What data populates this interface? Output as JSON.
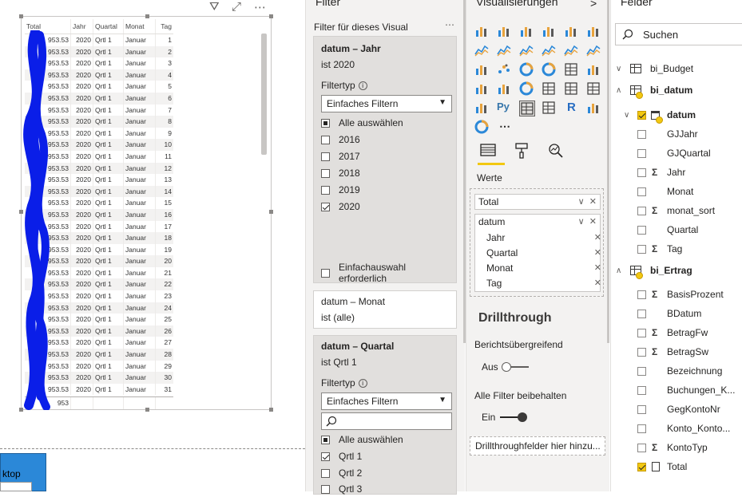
{
  "report": {
    "table": {
      "headers": [
        "Total",
        "Jahr",
        "Quartal",
        "Monat",
        "Tag"
      ],
      "rows": [
        [
          "953.53",
          "2020",
          "Qrtl 1",
          "Januar",
          "1"
        ],
        [
          "953.53",
          "2020",
          "Qrtl 1",
          "Januar",
          "2"
        ],
        [
          "953.53",
          "2020",
          "Qrtl 1",
          "Januar",
          "3"
        ],
        [
          "953.53",
          "2020",
          "Qrtl 1",
          "Januar",
          "4"
        ],
        [
          "953.53",
          "2020",
          "Qrtl 1",
          "Januar",
          "5"
        ],
        [
          "953.53",
          "2020",
          "Qrtl 1",
          "Januar",
          "6"
        ],
        [
          "953.53",
          "2020",
          "Qrtl 1",
          "Januar",
          "7"
        ],
        [
          "953.53",
          "2020",
          "Qrtl 1",
          "Januar",
          "8"
        ],
        [
          "953.53",
          "2020",
          "Qrtl 1",
          "Januar",
          "9"
        ],
        [
          "953.53",
          "2020",
          "Qrtl 1",
          "Januar",
          "10"
        ],
        [
          "953.53",
          "2020",
          "Qrtl 1",
          "Januar",
          "11"
        ],
        [
          "953.53",
          "2020",
          "Qrtl 1",
          "Januar",
          "12"
        ],
        [
          "953.53",
          "2020",
          "Qrtl 1",
          "Januar",
          "13"
        ],
        [
          "953.53",
          "2020",
          "Qrtl 1",
          "Januar",
          "14"
        ],
        [
          "953.53",
          "2020",
          "Qrtl 1",
          "Januar",
          "15"
        ],
        [
          "953.53",
          "2020",
          "Qrtl 1",
          "Januar",
          "16"
        ],
        [
          "953.53",
          "2020",
          "Qrtl 1",
          "Januar",
          "17"
        ],
        [
          "953.53",
          "2020",
          "Qrtl 1",
          "Januar",
          "18"
        ],
        [
          "953.53",
          "2020",
          "Qrtl 1",
          "Januar",
          "19"
        ],
        [
          "953.53",
          "2020",
          "Qrtl 1",
          "Januar",
          "20"
        ],
        [
          "953.53",
          "2020",
          "Qrtl 1",
          "Januar",
          "21"
        ],
        [
          "953.53",
          "2020",
          "Qrtl 1",
          "Januar",
          "22"
        ],
        [
          "953.53",
          "2020",
          "Qrtl 1",
          "Januar",
          "23"
        ],
        [
          "953.53",
          "2020",
          "Qrtl 1",
          "Januar",
          "24"
        ],
        [
          "953.53",
          "2020",
          "Qrtl 1",
          "Januar",
          "25"
        ],
        [
          "953.53",
          "2020",
          "Qrtl 1",
          "Januar",
          "26"
        ],
        [
          "953.53",
          "2020",
          "Qrtl 1",
          "Januar",
          "27"
        ],
        [
          "953.53",
          "2020",
          "Qrtl 1",
          "Januar",
          "28"
        ],
        [
          "953.53",
          "2020",
          "Qrtl 1",
          "Januar",
          "29"
        ],
        [
          "953.53",
          "2020",
          "Qrtl 1",
          "Januar",
          "30"
        ],
        [
          "953.53",
          "2020",
          "Qrtl 1",
          "Januar",
          "31"
        ]
      ],
      "total_row": [
        "953"
      ]
    },
    "header_icons": [
      "filter-icon",
      "focus-mode-icon",
      "more-options-icon"
    ],
    "header_glyphs": [
      "⛛",
      "⤢",
      "⋯"
    ],
    "desktop_tile_label": "ktop"
  },
  "filter_pane": {
    "title": "Filter",
    "visual_heading": "Filter für dieses Visual",
    "more_glyph": "⋯",
    "jahr_card": {
      "title": "datum – Jahr",
      "subtitle": "ist 2020",
      "filter_type_label": "Filtertyp",
      "filter_type_value": "Einfaches Filtern",
      "select_all": "Alle auswählen",
      "options": [
        {
          "label": "2016",
          "checked": false
        },
        {
          "label": "2017",
          "checked": false
        },
        {
          "label": "2018",
          "checked": false
        },
        {
          "label": "2019",
          "checked": false
        },
        {
          "label": "2020",
          "checked": true
        }
      ],
      "single_select": "Einfachauswahl erforderlich"
    },
    "monat_card": {
      "title": "datum – Monat",
      "subtitle": "ist (alle)"
    },
    "quartal_card": {
      "title": "datum – Quartal",
      "subtitle": "ist Qrtl 1",
      "filter_type_label": "Filtertyp",
      "filter_type_value": "Einfaches Filtern",
      "select_all": "Alle auswählen",
      "options": [
        {
          "label": "Qrtl 1",
          "checked": true
        },
        {
          "label": "Qrtl 2",
          "checked": false
        },
        {
          "label": "Qrtl 3",
          "checked": false
        }
      ]
    }
  },
  "viz_pane": {
    "title": "Visualisierungen",
    "collapse_glyph": ">",
    "icon_names": [
      "stacked-bar-icon",
      "stacked-column-icon",
      "clustered-bar-icon",
      "clustered-column-icon",
      "100-bar-icon",
      "100-column-icon",
      "line-chart-icon",
      "area-chart-icon",
      "stacked-area-icon",
      "line-column-icon",
      "line-clustered-icon",
      "ribbon-chart-icon",
      "waterfall-icon",
      "scatter-icon",
      "pie-chart-icon",
      "donut-chart-icon",
      "treemap-icon",
      "map-icon",
      "filled-map-icon",
      "funnel-icon",
      "gauge-icon",
      "card-icon",
      "multi-row-card-icon",
      "kpi-icon",
      "slicer-icon",
      "python-visual-icon",
      "table-visual-icon",
      "matrix-visual-icon",
      "r-visual-icon",
      "key-influencers-icon",
      "globe-icon",
      "more-visuals-icon"
    ],
    "special_glyphs": {
      "python": "Py",
      "r": "R",
      "more": "⋯"
    },
    "tabs": [
      "fields-tab-icon",
      "format-tab-icon",
      "analytics-tab-icon"
    ],
    "werte_label": "Werte",
    "wells": {
      "total": "Total",
      "datum": "datum",
      "datum_children": [
        "Jahr",
        "Quartal",
        "Monat",
        "Tag"
      ],
      "chevron_glyph": "∨",
      "remove_glyph": "✕"
    },
    "drillthrough": {
      "title": "Drillthrough",
      "cross_report_label": "Berichtsübergreifend",
      "cross_report_state": "Aus",
      "keep_filters_label": "Alle Filter beibehalten",
      "keep_filters_state": "Ein",
      "drop_placeholder": "Drillthroughfelder hier hinzu..."
    }
  },
  "fields_pane": {
    "title": "Felder",
    "search_placeholder": "Suchen",
    "tables": [
      {
        "name": "bi_Budget",
        "expanded": false,
        "has_badge": false
      },
      {
        "name": "bi_datum",
        "expanded": true,
        "has_badge": true
      },
      {
        "name": "bi_Ertrag",
        "expanded": true,
        "has_badge": true
      }
    ],
    "datum_hierarchy": {
      "name": "datum",
      "checked": true
    },
    "datum_fields": [
      {
        "name": "GJJahr",
        "icon": "none"
      },
      {
        "name": "GJQuartal",
        "icon": "none"
      },
      {
        "name": "Jahr",
        "icon": "sigma"
      },
      {
        "name": "Monat",
        "icon": "none"
      },
      {
        "name": "monat_sort",
        "icon": "sigma"
      },
      {
        "name": "Quartal",
        "icon": "none"
      },
      {
        "name": "Tag",
        "icon": "sigma"
      }
    ],
    "ertrag_fields": [
      {
        "name": "BasisProzent",
        "icon": "sigma",
        "checked": false
      },
      {
        "name": "BDatum",
        "icon": "none",
        "checked": false
      },
      {
        "name": "BetragFw",
        "icon": "sigma",
        "checked": false
      },
      {
        "name": "BetragSw",
        "icon": "sigma",
        "checked": false
      },
      {
        "name": "Bezeichnung",
        "icon": "none",
        "checked": false
      },
      {
        "name": "Buchungen_K...",
        "icon": "none",
        "checked": false
      },
      {
        "name": "GegKontoNr",
        "icon": "none",
        "checked": false
      },
      {
        "name": "Konto_Konto...",
        "icon": "none",
        "checked": false
      },
      {
        "name": "KontoTyp",
        "icon": "sigma",
        "checked": false
      },
      {
        "name": "Total",
        "icon": "calculator",
        "checked": true
      }
    ],
    "glyphs": {
      "sigma": "Σ",
      "expanded": "∨",
      "collapsed": ">"
    }
  },
  "colors": {
    "accent_yellow": "#f2c811",
    "pane_bg": "#f3f2f1",
    "scribble_blue": "#0a1ee8"
  }
}
